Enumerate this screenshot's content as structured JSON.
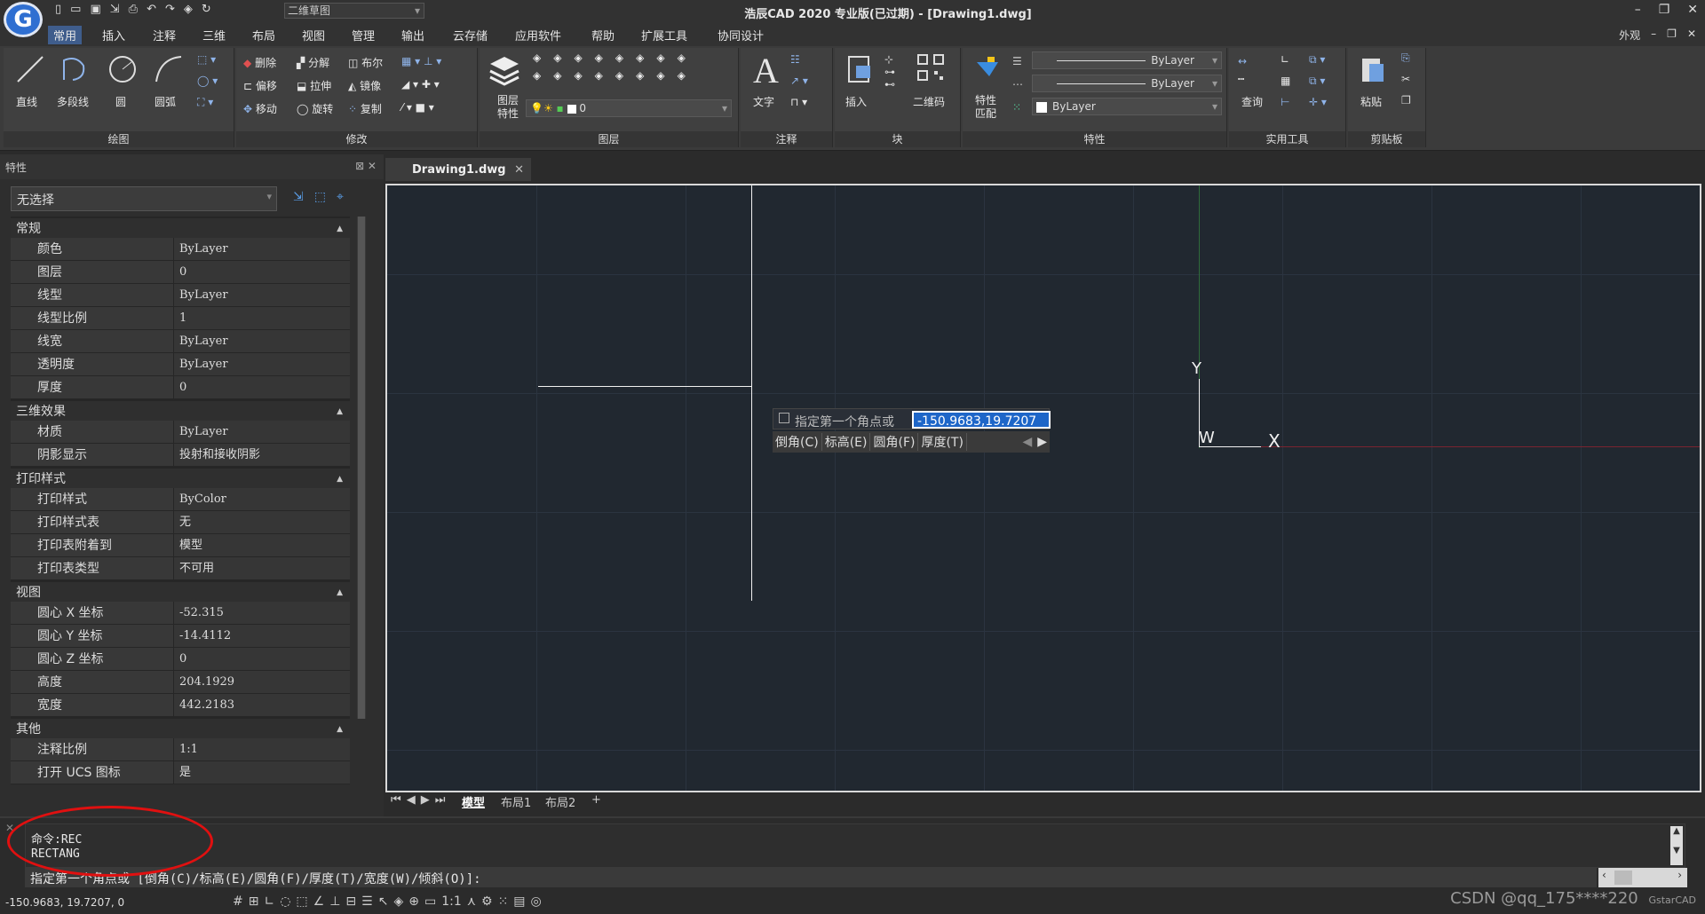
{
  "app": {
    "logo_letter": "G",
    "workspace": "二维草图",
    "title": "浩辰CAD 2020 专业版(已过期) - [Drawing1.dwg]",
    "window_controls": [
      "–",
      "❐",
      "✕"
    ]
  },
  "menu": {
    "tabs": [
      "常用",
      "插入",
      "注释",
      "三维",
      "布局",
      "视图",
      "管理",
      "输出",
      "云存储",
      "应用软件",
      "帮助",
      "扩展工具",
      "协同设计"
    ],
    "right": [
      "外观",
      "–",
      "❐",
      "✕"
    ]
  },
  "ribbon": {
    "draw": {
      "title": "绘图",
      "items": [
        "直线",
        "多段线",
        "圆",
        "圆弧"
      ]
    },
    "modify": {
      "title": "修改",
      "items": [
        "删除",
        "分解",
        "布尔",
        "偏移",
        "拉伸",
        "镜像",
        "移动",
        "旋转",
        "复制"
      ]
    },
    "layer": {
      "title": "图层",
      "big": "图层特性",
      "layer_value": "0"
    },
    "annotate": {
      "title": "注释",
      "big": "文字"
    },
    "block": {
      "title": "块",
      "items": [
        "插入",
        "二维码"
      ]
    },
    "properties": {
      "title": "特性",
      "big": "特性匹配",
      "color": "ByLayer",
      "linetype": "ByLayer",
      "lineweight": "ByLayer"
    },
    "utilities": {
      "title": "实用工具",
      "big": "查询"
    },
    "clipboard": {
      "title": "剪贴板",
      "big": "粘贴"
    }
  },
  "properties_panel": {
    "title": "特性",
    "selection": "无选择",
    "sections": [
      {
        "name": "常规",
        "rows": [
          [
            "颜色",
            "ByLayer"
          ],
          [
            "图层",
            "0"
          ],
          [
            "线型",
            "ByLayer"
          ],
          [
            "线型比例",
            "1"
          ],
          [
            "线宽",
            "ByLayer"
          ],
          [
            "透明度",
            "ByLayer"
          ],
          [
            "厚度",
            "0"
          ]
        ]
      },
      {
        "name": "三维效果",
        "rows": [
          [
            "材质",
            "ByLayer"
          ],
          [
            "阴影显示",
            "投射和接收阴影"
          ]
        ]
      },
      {
        "name": "打印样式",
        "rows": [
          [
            "打印样式",
            "ByColor"
          ],
          [
            "打印样式表",
            "无"
          ],
          [
            "打印表附着到",
            "模型"
          ],
          [
            "打印表类型",
            "不可用"
          ]
        ]
      },
      {
        "name": "视图",
        "rows": [
          [
            "圆心 X 坐标",
            "-52.315"
          ],
          [
            "圆心 Y 坐标",
            "-14.4112"
          ],
          [
            "圆心 Z 坐标",
            "0"
          ],
          [
            "高度",
            "204.1929"
          ],
          [
            "宽度",
            "442.2183"
          ]
        ]
      },
      {
        "name": "其他",
        "rows": [
          [
            "注释比例",
            "1:1"
          ],
          [
            "打开 UCS 图标",
            "是"
          ]
        ]
      }
    ]
  },
  "document": {
    "tab": "Drawing1.dwg"
  },
  "canvas": {
    "prompt_label": "指定第一个角点或",
    "prompt_value": "-150.9683,19.7207",
    "options": [
      "倒角(C)",
      "标高(E)",
      "圆角(F)",
      "厚度(T)"
    ],
    "ucs_y": "Y",
    "ucs_w": "W",
    "ucs_x": "X"
  },
  "layout_tabs": [
    "模型",
    "布局1",
    "布局2",
    "+"
  ],
  "command": {
    "history": [
      "命令:REC",
      "RECTANG"
    ],
    "input": "指定第一个角点或 [倒角(C)/标高(E)/圆角(F)/厚度(T)/宽度(W)/倾斜(O)]:"
  },
  "status": {
    "coords": "-150.9683, 19.7207, 0",
    "scale": "1:1"
  },
  "watermark": "CSDN @qq_175****220",
  "watermark2": "GstarCAD"
}
